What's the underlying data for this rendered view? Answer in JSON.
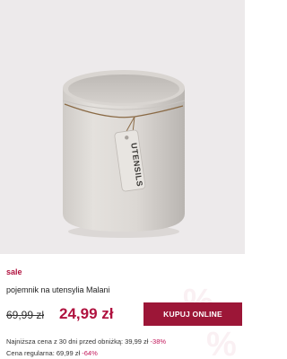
{
  "product": {
    "image_alt": "",
    "tag_text": "UTENSILS",
    "sale_label": "sale",
    "name": "pojemnik na utensylia Malani",
    "old_price": "69,99 zł",
    "new_price": "24,99 zł",
    "buy_button": "KUPUJ ONLINE"
  },
  "price_info": {
    "lowest_label": "Najniższa cena z 30 dni przed obniżką: 39,99 zł",
    "lowest_discount": "-38%",
    "regular_label": "Cena regularna: 69,99 zł",
    "regular_discount": "-64%"
  },
  "colors": {
    "accent": "#b0123f",
    "button_bg": "#9c1637",
    "image_bg": "#edeaeb"
  },
  "icons": {
    "watermark": "percent-icon"
  }
}
